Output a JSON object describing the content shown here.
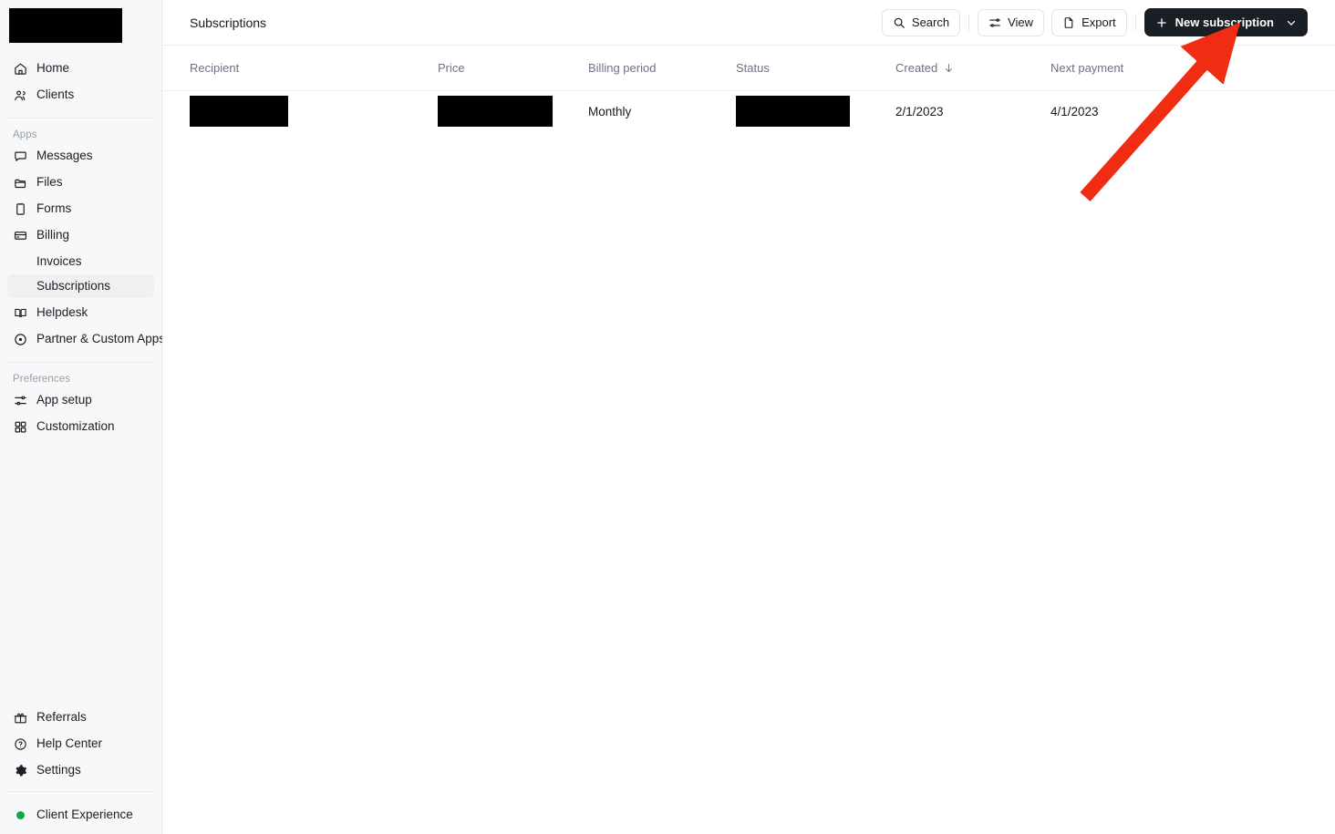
{
  "sidebar": {
    "logo": {
      "name": "workspace-logo",
      "redacted": true
    },
    "primary_items": [
      {
        "label": "Home",
        "icon": "home-icon"
      },
      {
        "label": "Clients",
        "icon": "people-icon"
      }
    ],
    "apps_section_label": "Apps",
    "app_items": [
      {
        "label": "Messages",
        "icon": "message-icon"
      },
      {
        "label": "Files",
        "icon": "folder-icon"
      },
      {
        "label": "Forms",
        "icon": "clipboard-icon"
      },
      {
        "label": "Billing",
        "icon": "credit-card-icon"
      }
    ],
    "billing_children": [
      {
        "label": "Invoices",
        "selected": false
      },
      {
        "label": "Subscriptions",
        "selected": true
      }
    ],
    "app_items_after": [
      {
        "label": "Helpdesk",
        "icon": "book-icon"
      },
      {
        "label": "Partner & Custom Apps",
        "icon": "puzzle-icon"
      }
    ],
    "preferences_section_label": "Preferences",
    "preference_items": [
      {
        "label": "App setup",
        "icon": "sliders-icon"
      },
      {
        "label": "Customization",
        "icon": "grid-icon"
      }
    ],
    "footer_items": [
      {
        "label": "Referrals",
        "icon": "gift-icon"
      },
      {
        "label": "Help Center",
        "icon": "question-circle-icon"
      },
      {
        "label": "Settings",
        "icon": "gear-icon"
      }
    ],
    "status_item": {
      "label": "Client Experience",
      "icon": "status-dot-icon",
      "color": "#15a34a"
    }
  },
  "topbar": {
    "title": "Subscriptions",
    "search_label": "Search",
    "view_label": "View",
    "export_label": "Export",
    "new_subscription_label": "New subscription"
  },
  "table": {
    "columns": [
      {
        "key": "recipient",
        "label": "Recipient",
        "sorted": false
      },
      {
        "key": "price",
        "label": "Price",
        "sorted": false
      },
      {
        "key": "billing_period",
        "label": "Billing period",
        "sorted": false
      },
      {
        "key": "status",
        "label": "Status",
        "sorted": false
      },
      {
        "key": "created",
        "label": "Created",
        "sorted": true,
        "sort_direction": "desc"
      },
      {
        "key": "next_payment",
        "label": "Next payment",
        "sorted": false
      }
    ],
    "rows": [
      {
        "recipient": "",
        "recipient_redacted": true,
        "price": "",
        "price_redacted": true,
        "billing_period": "Monthly",
        "status": "",
        "status_redacted": true,
        "created": "2/1/2023",
        "next_payment": "4/1/2023"
      }
    ]
  },
  "annotation": {
    "type": "arrow",
    "color": "#f02d12",
    "points_to": "new-subscription-button"
  }
}
